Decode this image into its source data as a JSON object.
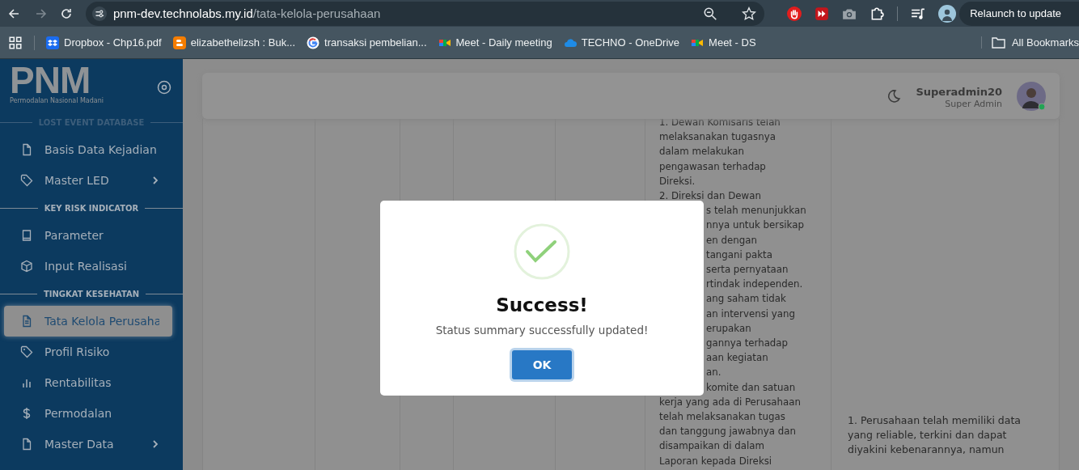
{
  "browser": {
    "nav": [
      {
        "kind": "back",
        "disabled": false
      },
      {
        "kind": "forward",
        "disabled": true
      },
      {
        "kind": "reload",
        "disabled": false
      }
    ],
    "url": {
      "host": "pnm-dev.technolabs.my.id",
      "path": "/tata-kelola-perusahaan"
    },
    "update_button": "Relaunch to update",
    "bookmarks": [
      {
        "kind": "dropbox",
        "label": "Dropbox - Chp16.pdf"
      },
      {
        "kind": "blogger",
        "label": "elizabethelizsh : Buk..."
      },
      {
        "kind": "google",
        "label": "transaksi pembelian..."
      },
      {
        "kind": "meet",
        "label": "Meet - Daily meeting"
      },
      {
        "kind": "cloud",
        "label": "TECHNO - OneDrive"
      },
      {
        "kind": "meet",
        "label": "Meet - DS"
      }
    ],
    "all_bookmarks": "All Bookmarks"
  },
  "sidebar": {
    "logo": {
      "title": "PNM",
      "subtitle": "Permodalan Nasional Madani"
    },
    "sections": [
      {
        "title": "LOST EVENT DATABASE",
        "items": [
          {
            "kind": "file",
            "label": "Basis Data Kejadian",
            "has_submenu": false,
            "selected": false
          },
          {
            "kind": "tag",
            "label": "Master LED",
            "has_submenu": true,
            "selected": false
          }
        ]
      },
      {
        "title": "KEY RISK INDICATOR",
        "items": [
          {
            "kind": "book",
            "label": "Parameter",
            "has_submenu": false,
            "selected": false
          },
          {
            "kind": "box",
            "label": "Input Realisasi",
            "has_submenu": false,
            "selected": false
          }
        ]
      },
      {
        "title": "TINGKAT KESEHATAN",
        "items": [
          {
            "kind": "doc",
            "label": "Tata Kelola Perusaha",
            "has_submenu": false,
            "selected": true
          },
          {
            "kind": "tag",
            "label": "Profil Risiko",
            "has_submenu": false,
            "selected": false
          },
          {
            "kind": "chart",
            "label": "Rentabilitas",
            "has_submenu": false,
            "selected": false
          },
          {
            "kind": "dollar",
            "label": "Permodalan",
            "has_submenu": false,
            "selected": false
          },
          {
            "kind": "file",
            "label": "Master Data",
            "has_submenu": true,
            "selected": false
          }
        ]
      }
    ]
  },
  "header": {
    "user_name": "Superadmin20",
    "user_role": "Super Admin"
  },
  "table": {
    "column_6_lines_above_dialog": [
      "1. Dewan Komisaris telah",
      "melaksanakan tugasnya",
      "dalam melakukan",
      "pengawasan terhadap",
      "Direksi.",
      "2. Direksi dan Dewan"
    ],
    "column_6_fragments_beside_dialog": [
      "s telah menunjukkan",
      "nnya untuk bersikap",
      "en dengan",
      "tangani pakta",
      "serta pernyataan",
      "rtindak independen.",
      "ang saham tidak",
      "an intervensi yang",
      "erupakan",
      "gannya terhadap",
      "aan kegiatan",
      "an.",
      "komite dan satuan"
    ],
    "column_6_lines_below_dialog": [
      "kerja yang ada di Perusahaan",
      "telah melaksanakan tugas",
      "dan tanggung jawabnya dan",
      "disampaikan di dalam",
      "Laporan kepada Direksi"
    ],
    "column_7_lines": [
      "1. Perusahaan telah memiliki data",
      "yang reliable, terkini dan dapat",
      "diyakini kebenarannya, namun"
    ]
  },
  "dialog": {
    "title": "Success!",
    "message": "Status summary successfully updated!",
    "button": "OK"
  }
}
